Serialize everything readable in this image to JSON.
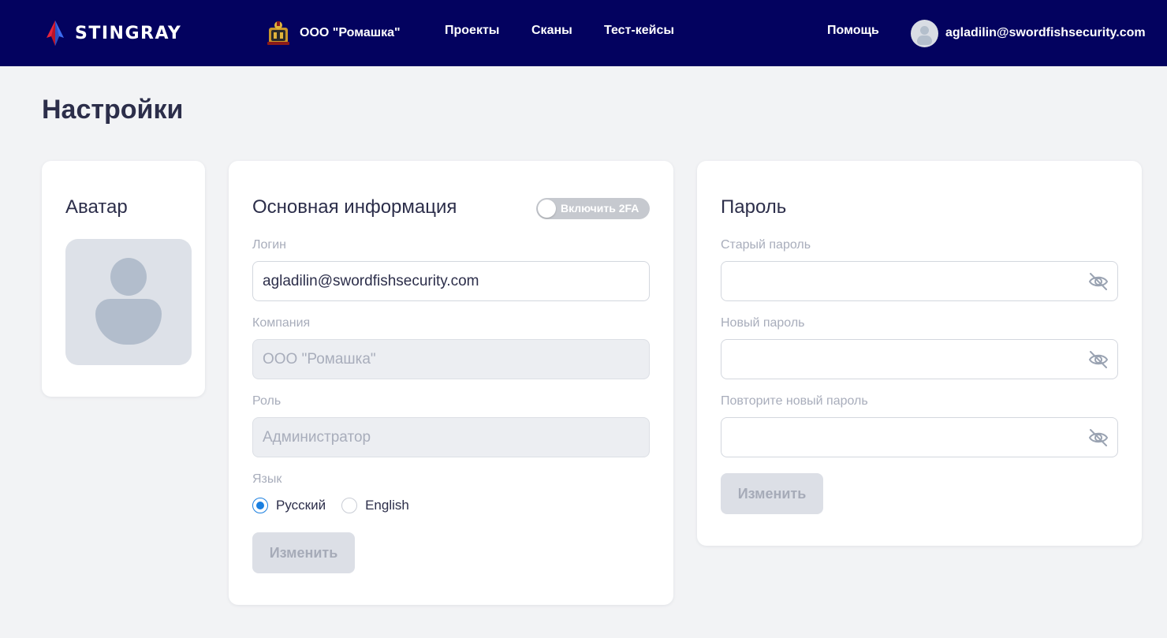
{
  "header": {
    "logo_text": "STINGRAY",
    "org_name": "ООО \"Ромашка\"",
    "nav": {
      "projects": "Проекты",
      "scans": "Сканы",
      "test_cases": "Тест-кейсы",
      "help": "Помощь"
    },
    "user_email": "agladilin@swordfishsecurity.com"
  },
  "page_title": "Настройки",
  "avatar_card": {
    "title": "Аватар"
  },
  "info_card": {
    "title": "Основная информация",
    "toggle_2fa_label": "Включить 2FA",
    "toggle_2fa_on": false,
    "login_label": "Логин",
    "login_value": "agladilin@swordfishsecurity.com",
    "company_label": "Компания",
    "company_value": "ООО \"Ромашка\"",
    "role_label": "Роль",
    "role_value": "Администратор",
    "language_label": "Язык",
    "languages": [
      {
        "label": "Русский",
        "checked": true
      },
      {
        "label": "English",
        "checked": false
      }
    ],
    "submit_label": "Изменить"
  },
  "password_card": {
    "title": "Пароль",
    "old_label": "Старый пароль",
    "new_label": "Новый пароль",
    "repeat_label": "Повторите новый пароль",
    "old_value": "",
    "new_value": "",
    "repeat_value": "",
    "submit_label": "Изменить"
  },
  "colors": {
    "header_bg": "#03025f",
    "page_bg": "#f2f3f5",
    "accent": "#1a7fe0",
    "disabled_btn": "#dcdfe6"
  },
  "icons": [
    "stingray-logo-icon",
    "org-emblem-icon",
    "user-avatar-icon",
    "eye-off-icon"
  ]
}
